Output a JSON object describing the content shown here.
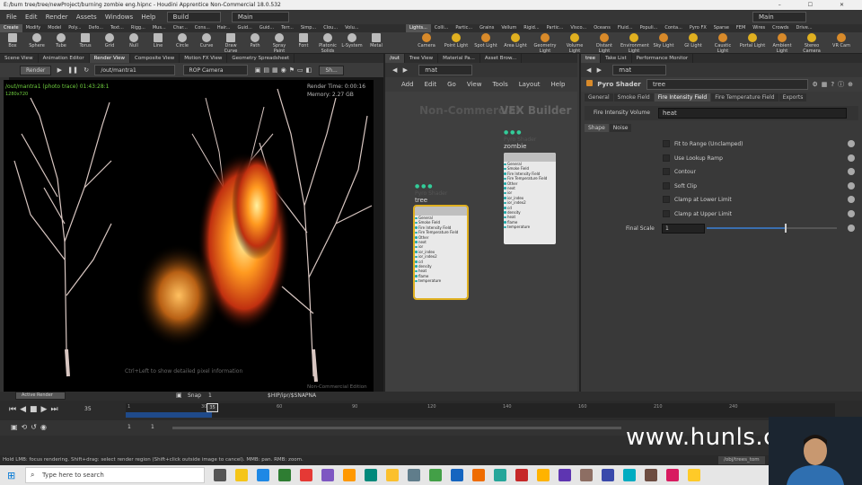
{
  "titlebar": {
    "title": "E:/burn tree/tree/newProject/burning zombie eng.hipnc - Houdini Apprentice Non-Commercial 18.0.532",
    "controls": "–  ☐  ✕"
  },
  "menubar": {
    "items": [
      "File",
      "Edit",
      "Render",
      "Assets",
      "Windows",
      "Help"
    ],
    "build": "Build",
    "desktop": "Main",
    "right_desktop": "Main"
  },
  "shelf": {
    "left_tabs": [
      "Create",
      "Modify",
      "Model",
      "Poly...",
      "Defo...",
      "Text...",
      "Rigg...",
      "Mus...",
      "Char...",
      "Cons...",
      "Hair...",
      "Guid...",
      "Guid...",
      "Terr...",
      "Simp...",
      "Clou...",
      "Volu..."
    ],
    "right_tabs": [
      "Lights...",
      "Colli...",
      "Partic...",
      "Grains",
      "Vellum",
      "Rigid...",
      "Partic...",
      "Visco...",
      "Oceans",
      "Fluid...",
      "Populi...",
      "Conta...",
      "Pyro FX",
      "Sparse",
      "FEM",
      "Wires",
      "Crowds",
      "Drive..."
    ],
    "left_tools": [
      "Box",
      "Sphere",
      "Tube",
      "Torus",
      "Grid",
      "Null",
      "Line",
      "Circle",
      "Curve",
      "Draw Curve",
      "Path",
      "Spray Paint",
      "Font",
      "Platonic Solids",
      "L-System",
      "Metal"
    ],
    "right_tools": [
      "Camera",
      "Point Light",
      "Spot Light",
      "Area Light",
      "Geometry Light",
      "Volume Light",
      "Distant Light",
      "Environment Light",
      "Sky Light",
      "GI Light",
      "Caustic Light",
      "Portal Light",
      "Ambient Light",
      "Stereo Camera",
      "VR Cam"
    ]
  },
  "scene": {
    "tabs": [
      "Scene View",
      "Animation Editor",
      "Render View",
      "Composite View",
      "Motion FX View",
      "Geometry Spreadsheet"
    ],
    "render_button": "Render",
    "out_path": "/out/mantra1",
    "camera": "ROP Camera",
    "sh_button": "Sh...",
    "overlay_path": "/out/mantra1 (photo trace) 01:43:28:1",
    "overlay_res": "1280x720",
    "render_time": "Render Time: 0:00:16",
    "memory": "Memory:   2.27 GB",
    "hint": "Ctrl+Left to show detailed pixel information",
    "noncommercial": "Non-Commercial Edition"
  },
  "net": {
    "tabs": [
      "/out",
      "Tree View",
      "Material Pa...",
      "Asset Brow..."
    ],
    "path": "mat",
    "menu": [
      "Add",
      "Edit",
      "Go",
      "View",
      "Tools",
      "Layout",
      "Help"
    ],
    "watermark": "Non-Commercial",
    "builder": "VEX Builder",
    "nodes": [
      {
        "type": "Pyro Shader",
        "name": "tree",
        "rows": [
          "General",
          "Smoke Field",
          "Fire Intensity Field",
          "Fire Temperature Field",
          "Other",
          "next",
          "ior",
          "ior_index",
          "ior_index2",
          "cd",
          "density",
          "heat",
          "flame",
          "temperature"
        ]
      },
      {
        "type": "Pyro Shader",
        "name": "zombie",
        "rows": [
          "General",
          "Smoke Field",
          "Fire Intensity Field",
          "Fire Temperature Field",
          "Other",
          "next",
          "ior",
          "ior_index",
          "ior_index2",
          "cd",
          "density",
          "heat",
          "flame",
          "temperature"
        ]
      }
    ]
  },
  "params": {
    "tabs": [
      "tree",
      "Take List",
      "Performance Monitor"
    ],
    "path": "mat",
    "node_type": "Pyro Shader",
    "node_name": "tree",
    "main_tabs": [
      "General",
      "Smoke Field",
      "Fire Intensity Field",
      "Fire Temperature Field",
      "Exports"
    ],
    "intensity_label": "Fire Intensity Volume",
    "intensity_value": "heat",
    "sub_tabs": [
      "Shape",
      "Noise"
    ],
    "toggles": [
      "Fit to Range (Unclamped)",
      "Use Lookup Ramp",
      "Contour",
      "Soft Clip",
      "Clamp at Lower Limit",
      "Clamp at Upper Limit"
    ],
    "final_scale_label": "Final Scale",
    "final_scale_value": "1",
    "final_scale_fraction": 0.6
  },
  "timeline": {
    "tabs": [
      "Active Render",
      "Snap",
      "1"
    ],
    "path": "$HIP/ipr/$SNAPNA",
    "current_frame": "35",
    "start_frame": "1",
    "end_frame": "1",
    "ticks": [
      "1",
      "30",
      "60",
      "90",
      "120",
      "140",
      "160",
      "210",
      "240"
    ]
  },
  "status": {
    "text": "Hold LMB: focus rendering. Shift+drag: select render region (Shift+click outside image to cancel). MMB: pan. RMB: zoom.",
    "path": "/obj/trees_tom"
  },
  "taskbar": {
    "search": "Type here to search"
  },
  "watermark": "www.hunls.com"
}
